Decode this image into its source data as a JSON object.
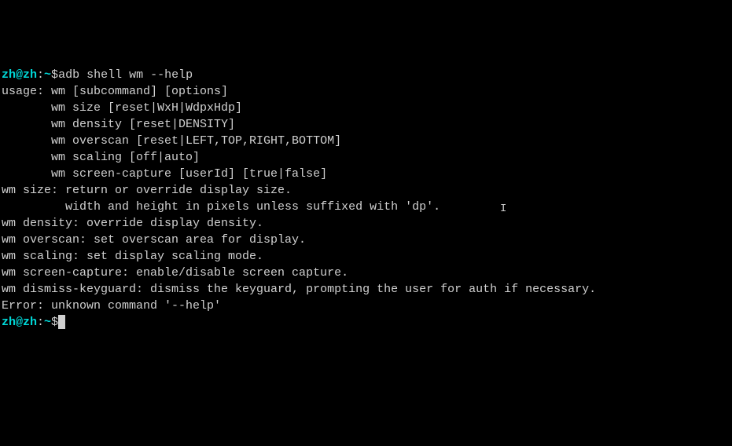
{
  "prompt1": {
    "user": "zh@zh",
    "sep": ":",
    "tilde": "~",
    "dollar": "$",
    "command": "adb shell wm --help"
  },
  "output": {
    "l1": "usage: wm [subcommand] [options]",
    "l2": "       wm size [reset|WxH|WdpxHdp]",
    "l3": "       wm density [reset|DENSITY]",
    "l4": "       wm overscan [reset|LEFT,TOP,RIGHT,BOTTOM]",
    "l5": "       wm scaling [off|auto]",
    "l6": "       wm screen-capture [userId] [true|false]",
    "l7": "",
    "l8": "wm size: return or override display size.",
    "l9": "         width and height in pixels unless suffixed with 'dp'.",
    "l10": "",
    "l11": "wm density: override display density.",
    "l12": "",
    "l13": "wm overscan: set overscan area for display.",
    "l14": "",
    "l15": "wm scaling: set display scaling mode.",
    "l16": "",
    "l17": "wm screen-capture: enable/disable screen capture.",
    "l18": "",
    "l19": "wm dismiss-keyguard: dismiss the keyguard, prompting the user for auth if necessary.",
    "l20": "",
    "l21": "",
    "l22": "Error: unknown command '--help'"
  },
  "prompt2": {
    "user": "zh@zh",
    "sep": ":",
    "tilde": "~",
    "dollar": "$"
  }
}
